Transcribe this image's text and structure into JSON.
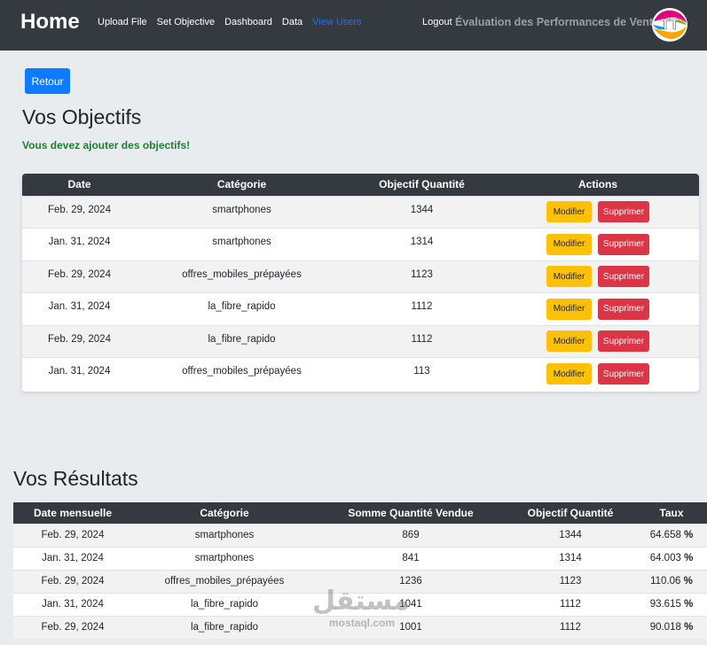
{
  "navbar": {
    "brand": "Home",
    "links": [
      "Upload File",
      "Set Objective",
      "Dashboard",
      "Data",
      "View Users"
    ],
    "logout": "Logout",
    "app_title": "Évaluation des Performances de Vente",
    "logo_text": "TT"
  },
  "back_label": "Retour",
  "objectives": {
    "title": "Vos Objectifs",
    "warning": "Vous devez ajouter des objectifs!",
    "headers": [
      "Date",
      "Catégorie",
      "Objectif Quantité",
      "Actions"
    ],
    "edit_label": "Modifier",
    "delete_label": "Supprimer",
    "rows": [
      {
        "date": "Feb. 29, 2024",
        "category": "smartphones",
        "qty": "1344"
      },
      {
        "date": "Jan. 31, 2024",
        "category": "smartphones",
        "qty": "1314"
      },
      {
        "date": "Feb. 29, 2024",
        "category": "offres_mobiles_prépayées",
        "qty": "1123"
      },
      {
        "date": "Jan. 31, 2024",
        "category": "la_fibre_rapido",
        "qty": "1112"
      },
      {
        "date": "Feb. 29, 2024",
        "category": "la_fibre_rapido",
        "qty": "1112"
      },
      {
        "date": "Jan. 31, 2024",
        "category": "offres_mobiles_prépayées",
        "qty": "113"
      }
    ]
  },
  "results": {
    "title": "Vos Résultats",
    "headers": [
      "Date mensuelle",
      "Catégorie",
      "Somme Quantité Vendue",
      "Objectif Quantité",
      "Taux"
    ],
    "rows": [
      {
        "date": "Feb. 29, 2024",
        "category": "smartphones",
        "sold": "869",
        "objective": "1344",
        "rate": "64.658",
        "unit": "%"
      },
      {
        "date": "Jan. 31, 2024",
        "category": "smartphones",
        "sold": "841",
        "objective": "1314",
        "rate": "64.003",
        "unit": "%"
      },
      {
        "date": "Feb. 29, 2024",
        "category": "offres_mobiles_prépayées",
        "sold": "1236",
        "objective": "1123",
        "rate": "110.06",
        "unit": "%"
      },
      {
        "date": "Jan. 31, 2024",
        "category": "la_fibre_rapido",
        "sold": "1041",
        "objective": "1112",
        "rate": "93.615",
        "unit": "%"
      },
      {
        "date": "Feb. 29, 2024",
        "category": "la_fibre_rapido",
        "sold": "1001",
        "objective": "1112",
        "rate": "90.018",
        "unit": "%"
      }
    ]
  },
  "watermark": {
    "arabic": "مستقل",
    "latin": "mostaql.com"
  },
  "colors": {
    "navbar": "#343a40",
    "primary": "#0d7bfd",
    "warning": "#ffc107",
    "danger": "#dc3545",
    "success": "#1e7e34",
    "active_link": "#2f6fd6"
  }
}
